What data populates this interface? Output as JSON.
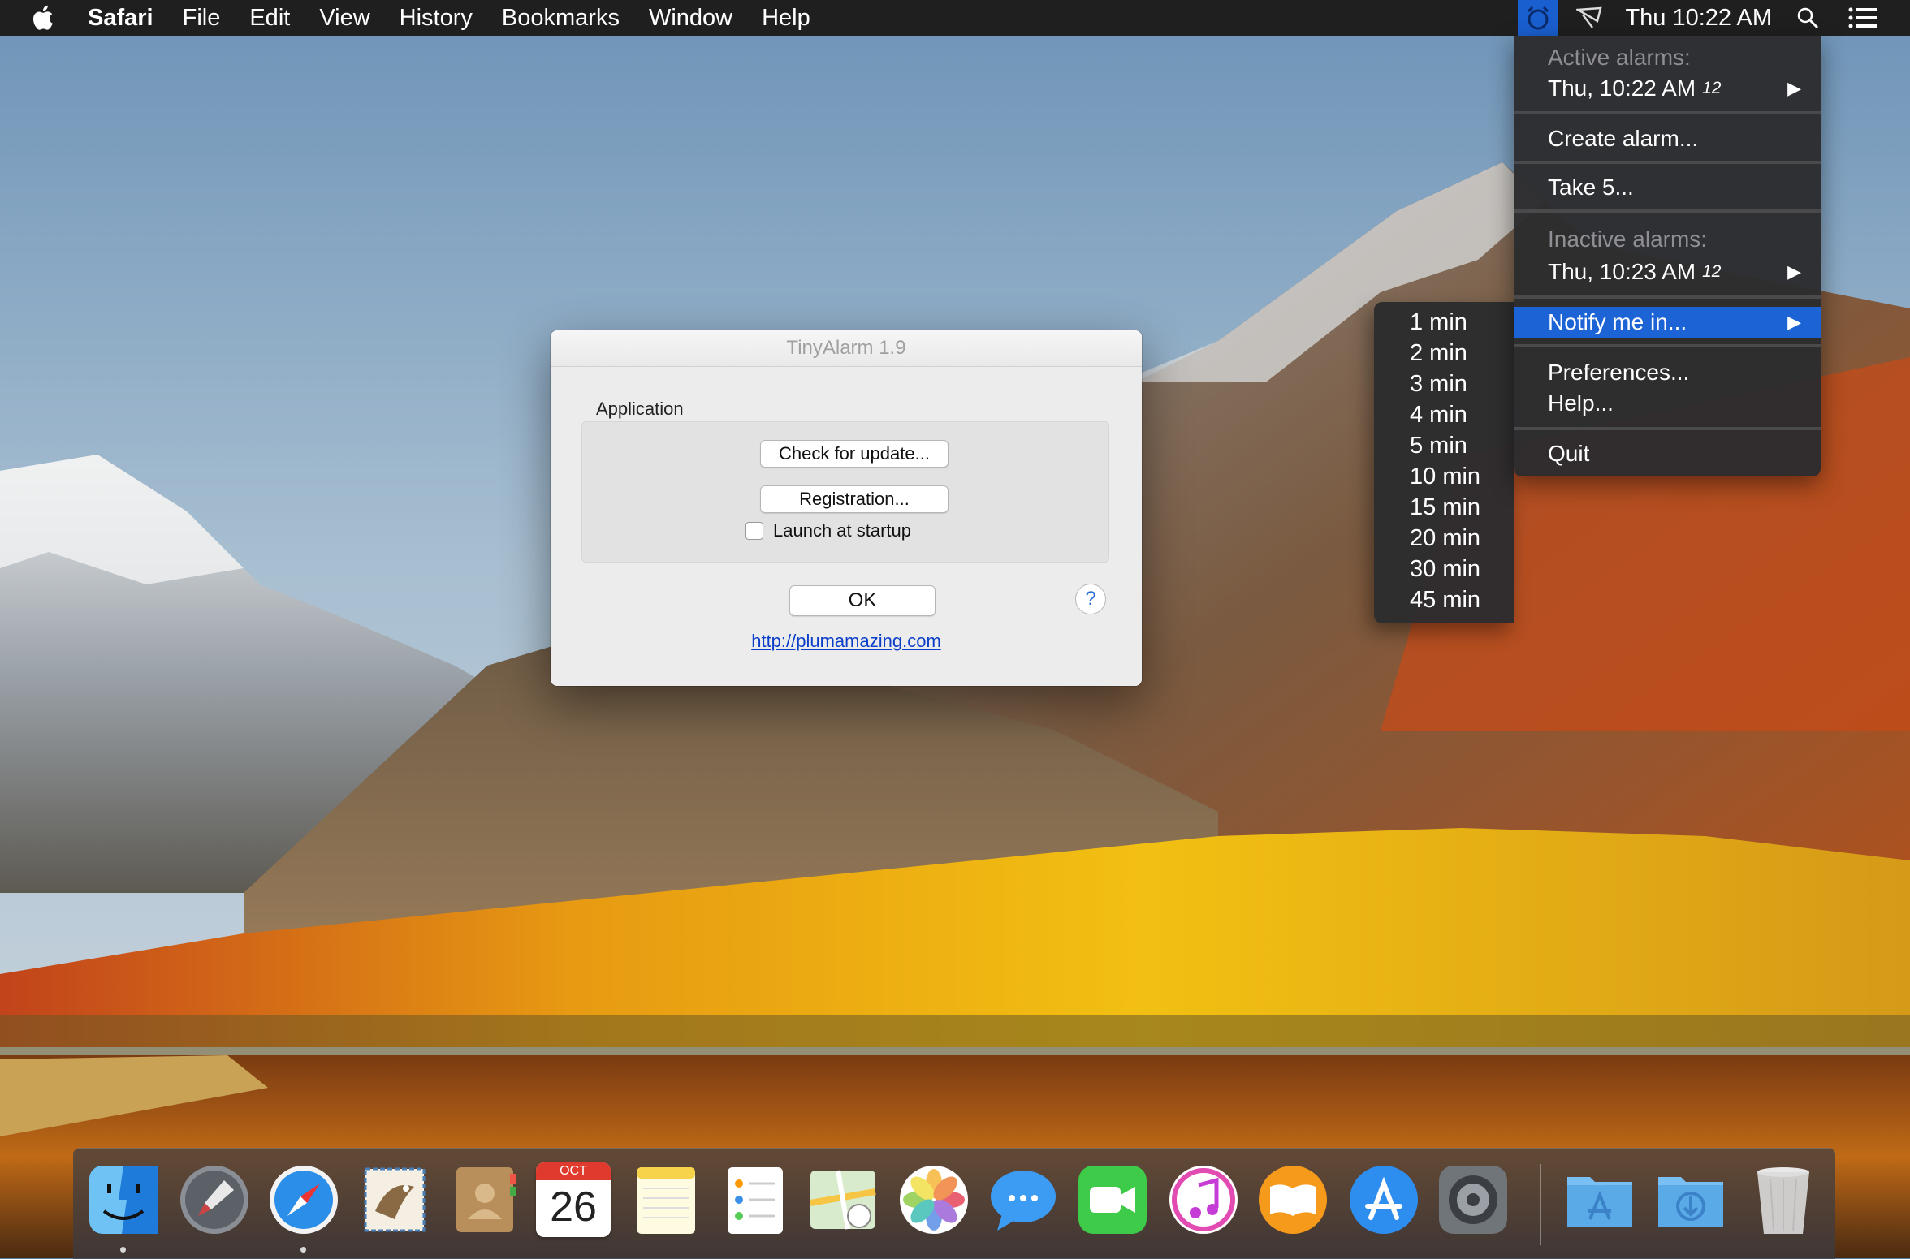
{
  "menubar": {
    "app_name": "Safari",
    "menus": [
      "File",
      "Edit",
      "View",
      "History",
      "Bookmarks",
      "Window",
      "Help"
    ],
    "clock": "Thu 10:22 AM",
    "icons": [
      "apple-logo-icon",
      "alarm-clock-icon",
      "airplay-icon",
      "spotlight-search-icon",
      "notification-center-icon"
    ]
  },
  "alarm_menu": {
    "active_header": "Active alarms:",
    "active_alarm": "Thu, 10:22 AM",
    "active_alarm_tag": "12",
    "create_alarm": "Create alarm...",
    "take5": "Take 5...",
    "inactive_header": "Inactive alarms:",
    "inactive_alarm": "Thu, 10:23 AM",
    "inactive_alarm_tag": "12",
    "notify_me": "Notify me in...",
    "preferences": "Preferences...",
    "help": "Help...",
    "quit": "Quit",
    "submenu_arrow": "▶"
  },
  "notify_submenu": [
    "1 min",
    "2 min",
    "3 min",
    "4 min",
    "5 min",
    "10 min",
    "15 min",
    "20 min",
    "30 min",
    "45 min"
  ],
  "dialog": {
    "title": "TinyAlarm 1.9",
    "group_label": "Application",
    "check_update": "Check for update...",
    "registration": "Registration...",
    "launch_at_startup": "Launch at startup",
    "launch_checked": false,
    "ok": "OK",
    "help": "?",
    "link": "http://plumamazing.com"
  },
  "dock": {
    "calendar_month": "OCT",
    "calendar_day": "26",
    "apps": [
      "finder-icon",
      "launchpad-icon",
      "safari-icon",
      "mail-icon",
      "contacts-icon",
      "calendar-icon",
      "notes-icon",
      "reminders-icon",
      "maps-icon",
      "photos-icon",
      "messages-icon",
      "facetime-icon",
      "itunes-icon",
      "ibooks-icon",
      "app-store-icon",
      "system-preferences-icon",
      "applications-folder-icon",
      "downloads-folder-icon",
      "trash-icon"
    ],
    "running": [
      "finder-icon",
      "safari-icon"
    ]
  }
}
